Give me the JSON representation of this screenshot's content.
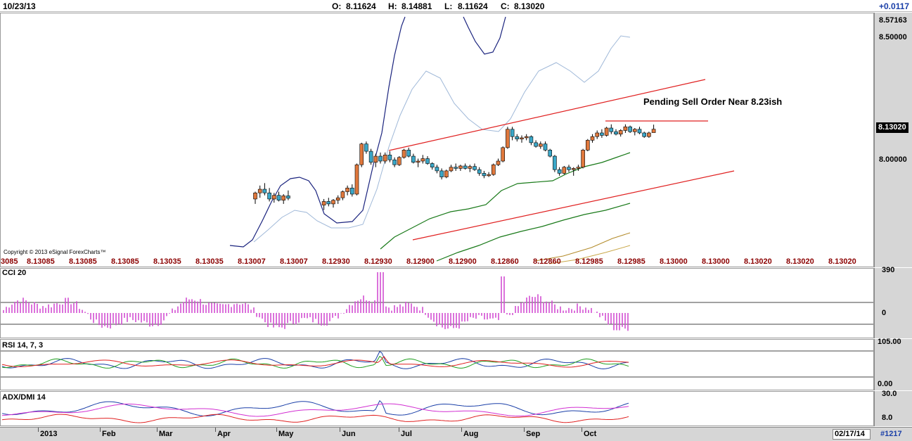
{
  "header": {
    "date": "10/23/13",
    "open_label": "O:",
    "open": "8.11624",
    "high_label": "H:",
    "high": "8.14881",
    "low_label": "L:",
    "low": "8.11624",
    "close_label": "C:",
    "close": "8.13020",
    "change": "+0.0117"
  },
  "price_axis": {
    "labels": [
      "8.57163",
      "8.50000",
      "8.13020",
      "8.00000"
    ],
    "current": "8.13020"
  },
  "annotation": "Pending Sell Order Near 8.23ish",
  "copyright": "Copyright © 2013 eSignal ForexCharts™",
  "quote_strip": [
    "3085",
    "8.13085",
    "8.13085",
    "8.13085",
    "8.13035",
    "8.13035",
    "8.13007",
    "8.13007",
    "8.12930",
    "8.12930",
    "8.12900",
    "8.12900",
    "8.12860",
    "8.12860",
    "8.12985",
    "8.12985",
    "8.13000",
    "8.13000",
    "8.13020",
    "8.13020",
    "8.13020"
  ],
  "indicators": {
    "cci": {
      "title": "CCI 20",
      "top": "390",
      "zero": "0"
    },
    "rsi": {
      "title": "RSI 14, 7, 3",
      "top": "105.00",
      "bottom": "0.00"
    },
    "adx": {
      "title": "ADX/DMI 14",
      "top": "30.0",
      "bottom": "8.0"
    }
  },
  "months": [
    "2013",
    "Feb",
    "Mar",
    "Apr",
    "May",
    "Jun",
    "Jul",
    "Aug",
    "Sep",
    "Oct"
  ],
  "bottom": {
    "date": "02/17/14",
    "id": "#1217"
  },
  "colors": {
    "bull_body": "#e0783c",
    "bear_body": "#3aa7c8",
    "trendline": "#e02020",
    "bollinger_outer": "#1a237e",
    "bollinger_inner": "#9fb8d8",
    "ma_green": "#1a7a1a",
    "ma_olive": "#b38b2a",
    "cci": "#d24fd2",
    "quote_text": "#8b0000"
  },
  "chart_data": {
    "type": "candlestick",
    "x_axis": {
      "ticks": [
        "2013",
        "Feb",
        "Mar",
        "Apr",
        "May",
        "Jun",
        "Jul",
        "Aug",
        "Sep",
        "Oct"
      ]
    },
    "y_axis": {
      "ticks": [
        8.0,
        8.1302,
        8.5,
        8.57163
      ]
    },
    "last_close": 8.1302,
    "candles": [
      {
        "t": "May",
        "o": 7.845,
        "h": 7.875,
        "l": 7.825,
        "c": 7.87
      },
      {
        "t": "May",
        "o": 7.87,
        "h": 7.9,
        "l": 7.85,
        "c": 7.885
      },
      {
        "t": "May",
        "o": 7.885,
        "h": 7.91,
        "l": 7.86,
        "c": 7.87
      },
      {
        "t": "May",
        "o": 7.87,
        "h": 7.89,
        "l": 7.835,
        "c": 7.845
      },
      {
        "t": "May",
        "o": 7.845,
        "h": 7.87,
        "l": 7.83,
        "c": 7.86
      },
      {
        "t": "May",
        "o": 7.86,
        "h": 7.875,
        "l": 7.835,
        "c": 7.84
      },
      {
        "t": "May",
        "o": 7.84,
        "h": 7.865,
        "l": 7.825,
        "c": 7.858
      },
      {
        "t": "May",
        "o": 7.858,
        "h": 7.88,
        "l": 7.84,
        "c": 7.848
      },
      {
        "t": "Jun",
        "o": 7.82,
        "h": 7.845,
        "l": 7.8,
        "c": 7.835
      },
      {
        "t": "Jun",
        "o": 7.835,
        "h": 7.85,
        "l": 7.815,
        "c": 7.825
      },
      {
        "t": "Jun",
        "o": 7.825,
        "h": 7.845,
        "l": 7.81,
        "c": 7.84
      },
      {
        "t": "Jun",
        "o": 7.84,
        "h": 7.86,
        "l": 7.825,
        "c": 7.85
      },
      {
        "t": "Jun",
        "o": 7.85,
        "h": 7.88,
        "l": 7.84,
        "c": 7.875
      },
      {
        "t": "Jun",
        "o": 7.875,
        "h": 7.9,
        "l": 7.86,
        "c": 7.89
      },
      {
        "t": "Jun",
        "o": 7.89,
        "h": 7.905,
        "l": 7.855,
        "c": 7.865
      },
      {
        "t": "Jun",
        "o": 7.865,
        "h": 7.99,
        "l": 7.86,
        "c": 7.985
      },
      {
        "t": "Jun",
        "o": 7.985,
        "h": 8.075,
        "l": 7.975,
        "c": 8.07
      },
      {
        "t": "Jun",
        "o": 8.07,
        "h": 8.08,
        "l": 8.03,
        "c": 8.04
      },
      {
        "t": "Jun",
        "o": 8.04,
        "h": 8.05,
        "l": 7.985,
        "c": 7.995
      },
      {
        "t": "Jun",
        "o": 7.995,
        "h": 8.03,
        "l": 7.975,
        "c": 8.02
      },
      {
        "t": "Jul",
        "o": 8.02,
        "h": 8.035,
        "l": 7.99,
        "c": 8.0
      },
      {
        "t": "Jul",
        "o": 8.0,
        "h": 8.035,
        "l": 7.99,
        "c": 8.025
      },
      {
        "t": "Jul",
        "o": 8.025,
        "h": 8.04,
        "l": 7.995,
        "c": 8.005
      },
      {
        "t": "Jul",
        "o": 8.005,
        "h": 8.015,
        "l": 7.975,
        "c": 7.985
      },
      {
        "t": "Jul",
        "o": 7.985,
        "h": 8.02,
        "l": 7.98,
        "c": 8.015
      },
      {
        "t": "Jul",
        "o": 8.015,
        "h": 8.05,
        "l": 8.01,
        "c": 8.045
      },
      {
        "t": "Jul",
        "o": 8.045,
        "h": 8.055,
        "l": 8.015,
        "c": 8.02
      },
      {
        "t": "Jul",
        "o": 8.02,
        "h": 8.03,
        "l": 7.99,
        "c": 7.995
      },
      {
        "t": "Jul",
        "o": 7.995,
        "h": 8.01,
        "l": 7.975,
        "c": 8.0
      },
      {
        "t": "Jul",
        "o": 8.0,
        "h": 8.025,
        "l": 7.99,
        "c": 8.01
      },
      {
        "t": "Jul",
        "o": 8.01,
        "h": 8.02,
        "l": 7.985,
        "c": 7.99
      },
      {
        "t": "Jul",
        "o": 7.99,
        "h": 7.995,
        "l": 7.965,
        "c": 7.975
      },
      {
        "t": "Jul",
        "o": 7.975,
        "h": 7.985,
        "l": 7.95,
        "c": 7.96
      },
      {
        "t": "Jul",
        "o": 7.96,
        "h": 7.97,
        "l": 7.925,
        "c": 7.935
      },
      {
        "t": "Aug",
        "o": 7.935,
        "h": 7.965,
        "l": 7.93,
        "c": 7.96
      },
      {
        "t": "Aug",
        "o": 7.96,
        "h": 7.985,
        "l": 7.955,
        "c": 7.975
      },
      {
        "t": "Aug",
        "o": 7.975,
        "h": 7.99,
        "l": 7.96,
        "c": 7.97
      },
      {
        "t": "Aug",
        "o": 7.97,
        "h": 7.985,
        "l": 7.96,
        "c": 7.98
      },
      {
        "t": "Aug",
        "o": 7.98,
        "h": 7.99,
        "l": 7.965,
        "c": 7.97
      },
      {
        "t": "Aug",
        "o": 7.97,
        "h": 7.985,
        "l": 7.955,
        "c": 7.978
      },
      {
        "t": "Aug",
        "o": 7.978,
        "h": 7.99,
        "l": 7.96,
        "c": 7.965
      },
      {
        "t": "Aug",
        "o": 7.965,
        "h": 7.975,
        "l": 7.94,
        "c": 7.95
      },
      {
        "t": "Aug",
        "o": 7.95,
        "h": 7.96,
        "l": 7.93,
        "c": 7.94
      },
      {
        "t": "Aug",
        "o": 7.94,
        "h": 7.955,
        "l": 7.935,
        "c": 7.945
      },
      {
        "t": "Aug",
        "o": 7.945,
        "h": 7.99,
        "l": 7.94,
        "c": 7.985
      },
      {
        "t": "Aug",
        "o": 7.985,
        "h": 8.01,
        "l": 7.98,
        "c": 8.0
      },
      {
        "t": "Aug",
        "o": 8.0,
        "h": 8.06,
        "l": 7.995,
        "c": 8.055
      },
      {
        "t": "Aug",
        "o": 8.055,
        "h": 8.14,
        "l": 8.05,
        "c": 8.13
      },
      {
        "t": "Aug",
        "o": 8.13,
        "h": 8.14,
        "l": 8.085,
        "c": 8.1
      },
      {
        "t": "Aug",
        "o": 8.1,
        "h": 8.11,
        "l": 8.08,
        "c": 8.09
      },
      {
        "t": "Sep",
        "o": 8.09,
        "h": 8.105,
        "l": 8.075,
        "c": 8.095
      },
      {
        "t": "Sep",
        "o": 8.095,
        "h": 8.11,
        "l": 8.085,
        "c": 8.1
      },
      {
        "t": "Sep",
        "o": 8.1,
        "h": 8.105,
        "l": 8.065,
        "c": 8.075
      },
      {
        "t": "Sep",
        "o": 8.075,
        "h": 8.085,
        "l": 8.055,
        "c": 8.06
      },
      {
        "t": "Sep",
        "o": 8.06,
        "h": 8.08,
        "l": 8.05,
        "c": 8.07
      },
      {
        "t": "Sep",
        "o": 8.07,
        "h": 8.08,
        "l": 8.04,
        "c": 8.045
      },
      {
        "t": "Sep",
        "o": 8.045,
        "h": 8.05,
        "l": 8.015,
        "c": 8.02
      },
      {
        "t": "Sep",
        "o": 8.02,
        "h": 8.025,
        "l": 7.955,
        "c": 7.965
      },
      {
        "t": "Sep",
        "o": 7.965,
        "h": 7.975,
        "l": 7.94,
        "c": 7.95
      },
      {
        "t": "Sep",
        "o": 7.95,
        "h": 7.98,
        "l": 7.945,
        "c": 7.975
      },
      {
        "t": "Sep",
        "o": 7.975,
        "h": 7.985,
        "l": 7.955,
        "c": 7.965
      },
      {
        "t": "Sep",
        "o": 7.965,
        "h": 7.975,
        "l": 7.94,
        "c": 7.97
      },
      {
        "t": "Sep",
        "o": 7.97,
        "h": 7.985,
        "l": 7.96,
        "c": 7.975
      },
      {
        "t": "Sep",
        "o": 7.975,
        "h": 8.05,
        "l": 7.97,
        "c": 8.045
      },
      {
        "t": "Oct",
        "o": 8.045,
        "h": 8.09,
        "l": 8.04,
        "c": 8.085
      },
      {
        "t": "Oct",
        "o": 8.085,
        "h": 8.11,
        "l": 8.075,
        "c": 8.1
      },
      {
        "t": "Oct",
        "o": 8.1,
        "h": 8.125,
        "l": 8.09,
        "c": 8.115
      },
      {
        "t": "Oct",
        "o": 8.115,
        "h": 8.13,
        "l": 8.095,
        "c": 8.105
      },
      {
        "t": "Oct",
        "o": 8.105,
        "h": 8.14,
        "l": 8.1,
        "c": 8.135
      },
      {
        "t": "Oct",
        "o": 8.135,
        "h": 8.15,
        "l": 8.11,
        "c": 8.12
      },
      {
        "t": "Oct",
        "o": 8.12,
        "h": 8.13,
        "l": 8.105,
        "c": 8.11
      },
      {
        "t": "Oct",
        "o": 8.11,
        "h": 8.13,
        "l": 8.1,
        "c": 8.125
      },
      {
        "t": "Oct",
        "o": 8.125,
        "h": 8.15,
        "l": 8.115,
        "c": 8.14
      },
      {
        "t": "Oct",
        "o": 8.14,
        "h": 8.145,
        "l": 8.115,
        "c": 8.12
      },
      {
        "t": "Oct",
        "o": 8.12,
        "h": 8.135,
        "l": 8.105,
        "c": 8.13
      },
      {
        "t": "Oct",
        "o": 8.13,
        "h": 8.14,
        "l": 8.11,
        "c": 8.115
      },
      {
        "t": "Oct",
        "o": 8.115,
        "h": 8.12,
        "l": 8.095,
        "c": 8.1
      },
      {
        "t": "Oct",
        "o": 8.1,
        "h": 8.12,
        "l": 8.095,
        "c": 8.115
      },
      {
        "t": "Oct",
        "o": 8.11624,
        "h": 8.14881,
        "l": 8.11624,
        "c": 8.1302
      }
    ]
  }
}
